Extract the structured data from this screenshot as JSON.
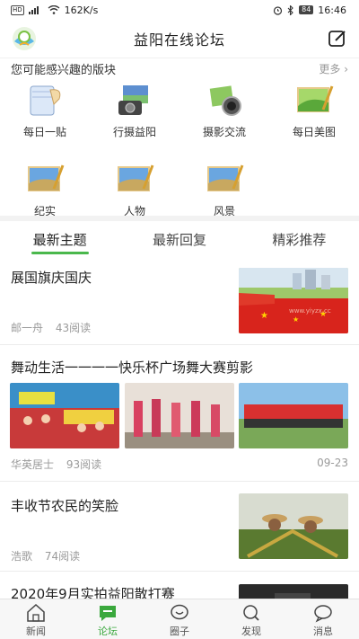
{
  "status_bar": {
    "network_badge": "HD",
    "signal": "4G",
    "speed": "162K/s",
    "battery": "84",
    "time": "16:46"
  },
  "header": {
    "title": "益阳在线论坛",
    "logo_icon": "app-logo-icon",
    "edit_icon": "compose-icon"
  },
  "boards_section": {
    "title": "您可能感兴趣的版块",
    "more_label": "更多",
    "more_icon": "chevron-right-icon"
  },
  "boards": [
    {
      "label": "每日一贴",
      "icon": "notepad-icon"
    },
    {
      "label": "行摄益阳",
      "icon": "camera-photo-icon"
    },
    {
      "label": "摄影交流",
      "icon": "camera-lens-icon"
    },
    {
      "label": "每日美图",
      "icon": "green-landscape-icon"
    },
    {
      "label": "纪实",
      "icon": "picture-icon"
    },
    {
      "label": "人物",
      "icon": "picture-icon"
    },
    {
      "label": "风景",
      "icon": "picture-icon"
    }
  ],
  "tabs": [
    {
      "label": "最新主题",
      "active": true
    },
    {
      "label": "最新回复",
      "active": false
    },
    {
      "label": "精彩推荐",
      "active": false
    }
  ],
  "posts": [
    {
      "title": "展国旗庆国庆",
      "author": "邮一舟",
      "views": "43阅读",
      "date": "",
      "watermark": "www.yiyzx.cc"
    },
    {
      "title": "舞动生活一一一一快乐杯广场舞大赛剪影",
      "author": "华英居士",
      "views": "93阅读",
      "date": "09-23"
    },
    {
      "title": "丰收节农民的笑脸",
      "author": "浩歌",
      "views": "74阅读",
      "date": ""
    },
    {
      "title": "2020年9月实拍益阳散打赛",
      "author": "",
      "views": "",
      "date": ""
    }
  ],
  "bottom_nav": [
    {
      "label": "新闻",
      "icon": "home-icon",
      "active": false
    },
    {
      "label": "论坛",
      "icon": "forum-chat-icon",
      "active": true
    },
    {
      "label": "圈子",
      "icon": "circle-chat-icon",
      "active": false
    },
    {
      "label": "发现",
      "icon": "search-icon",
      "active": false
    },
    {
      "label": "消息",
      "icon": "message-icon",
      "active": false
    }
  ],
  "colors": {
    "accent": "#4ab84c",
    "meta_text": "#9a9a9a",
    "divider": "#f2f2f2"
  }
}
